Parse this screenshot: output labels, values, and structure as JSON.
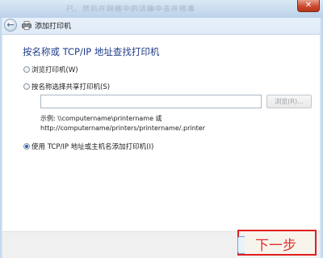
{
  "window": {
    "title": "添加打印机",
    "close_glyph": "✕",
    "back_glyph": "←",
    "background_text": "已、然后在网络中的话输中去在修事"
  },
  "main": {
    "heading": "按名称或 TCP/IP 地址查找打印机",
    "options": [
      {
        "label": "浏览打印机(W)",
        "checked": false
      },
      {
        "label": "按名称选择共享打印机(S)",
        "checked": false
      },
      {
        "label": "使用 TCP/IP 地址或主机名添加打印机(I)",
        "checked": true
      }
    ],
    "share_input": {
      "value": "",
      "placeholder": ""
    },
    "browse_label": "浏览(R)...",
    "example_line1": "示例: \\\\computername\\printername 或",
    "example_line2": "http://computername/printers/printername/.printer"
  },
  "footer": {
    "next_label": "下一步"
  },
  "colors": {
    "heading": "#1f3d8a",
    "highlight": "#e02020"
  }
}
